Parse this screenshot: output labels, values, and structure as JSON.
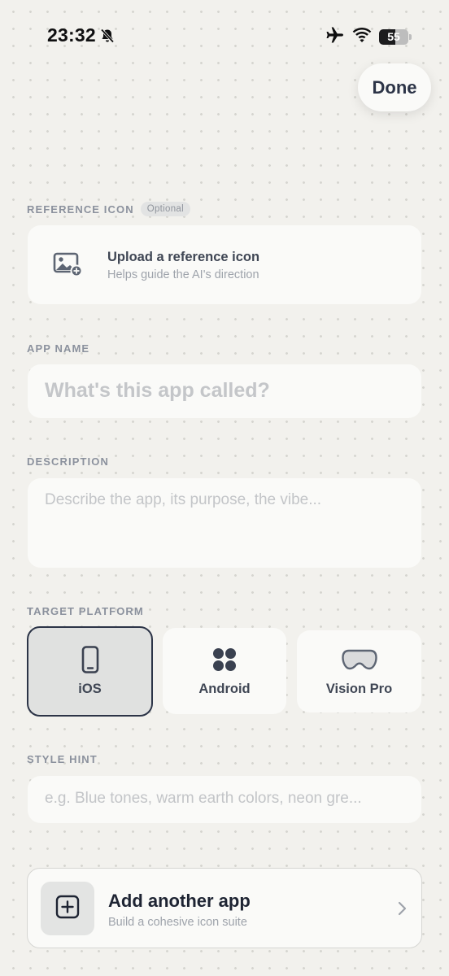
{
  "status_bar": {
    "time": "23:32",
    "battery": "55",
    "icons": [
      "bell-slash-icon",
      "airplane-icon",
      "wifi-icon",
      "battery-icon"
    ]
  },
  "header": {
    "done_label": "Done"
  },
  "reference_icon": {
    "label": "REFERENCE ICON",
    "badge": "Optional",
    "upload_title": "Upload a reference icon",
    "upload_subtitle": "Helps guide the AI's direction",
    "icon": "image-add-icon"
  },
  "app_name": {
    "label": "APP NAME",
    "value": "",
    "placeholder": "What's this app called?"
  },
  "description": {
    "label": "DESCRIPTION",
    "value": "",
    "placeholder": "Describe the app, its purpose, the vibe..."
  },
  "target_platform": {
    "label": "TARGET PLATFORM",
    "options": [
      {
        "label": "iOS",
        "icon": "iphone-icon",
        "selected": true
      },
      {
        "label": "Android",
        "icon": "android-grid-icon",
        "selected": false
      },
      {
        "label": "Vision Pro",
        "icon": "vision-pro-icon",
        "selected": false
      }
    ]
  },
  "style_hint": {
    "label": "STYLE HINT",
    "value": "",
    "placeholder": "e.g. Blue tones, warm earth colors, neon gre..."
  },
  "add_app": {
    "title": "Add another app",
    "subtitle": "Build a cohesive icon suite",
    "icon": "plus-square-icon"
  },
  "colors": {
    "background": "#f2f1ed",
    "card": "#fafaf8",
    "accent": "#2c3447",
    "label": "#8b919d"
  }
}
